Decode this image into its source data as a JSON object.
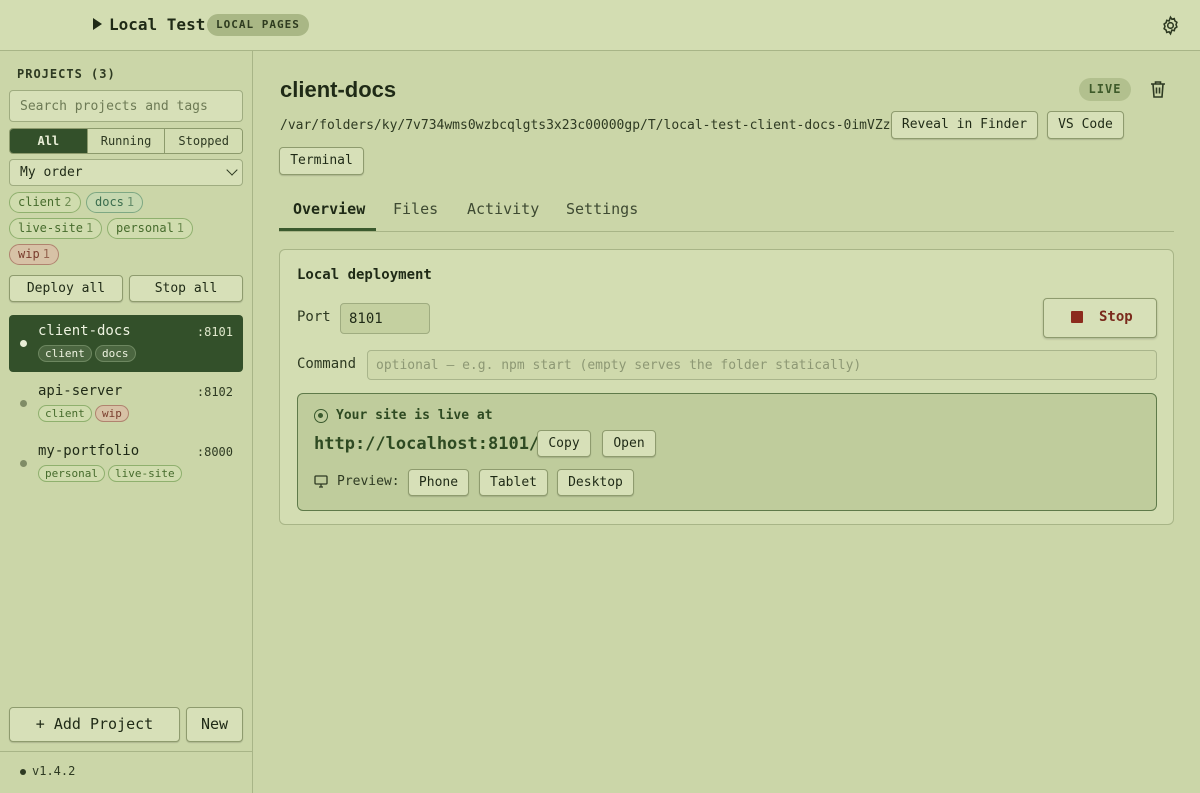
{
  "topbar": {
    "title": "Local Test",
    "badge": "LOCAL PAGES",
    "settings_icon": "gear-icon"
  },
  "sidebar": {
    "projects_heading": "PROJECTS (3)",
    "search_placeholder": "Search projects and tags",
    "filters": [
      "All",
      "Running",
      "Stopped"
    ],
    "active_filter": "All",
    "sort_value": "My order",
    "tags": [
      {
        "name": "client",
        "count": "2"
      },
      {
        "name": "docs",
        "count": "1"
      },
      {
        "name": "live-site",
        "count": "1"
      },
      {
        "name": "personal",
        "count": "1"
      },
      {
        "name": "wip",
        "count": "1"
      }
    ],
    "deploy_all": "Deploy all",
    "stop_all": "Stop all",
    "projects": [
      {
        "name": "client-docs",
        "port": ":8101",
        "tags": [
          "client",
          "docs"
        ]
      },
      {
        "name": "api-server",
        "port": ":8102",
        "tags": [
          "client",
          "wip"
        ]
      },
      {
        "name": "my-portfolio",
        "port": ":8000",
        "tags": [
          "personal",
          "live-site"
        ]
      }
    ],
    "add_project": "+ Add Project",
    "new": "New",
    "version": "v1.4.2"
  },
  "main": {
    "title": "client-docs",
    "status": "LIVE",
    "path": "/var/folders/ky/7v734wms0wzbcqlgts3x23c00000gp/T/local-test-client-docs-0imVZz",
    "reveal": "Reveal in Finder",
    "vscode": "VS Code",
    "terminal": "Terminal",
    "tabs": [
      "Overview",
      "Files",
      "Activity",
      "Settings"
    ],
    "active_tab": "Overview",
    "card": {
      "heading": "Local deployment",
      "port_label": "Port",
      "port_value": "8101",
      "stop": "Stop",
      "command_label": "Command",
      "command_placeholder": "optional — e.g. npm start (empty serves the folder statically)",
      "live_heading": "Your site is live at",
      "url": "http://localhost:8101/",
      "copy": "Copy",
      "open": "Open",
      "preview_label": "Preview:",
      "preview_phone": "Phone",
      "preview_tablet": "Tablet",
      "preview_desktop": "Desktop"
    }
  },
  "colors": {
    "accent": "#33502a",
    "background": "#cbd6a8",
    "stop": "#8c2b1d"
  }
}
